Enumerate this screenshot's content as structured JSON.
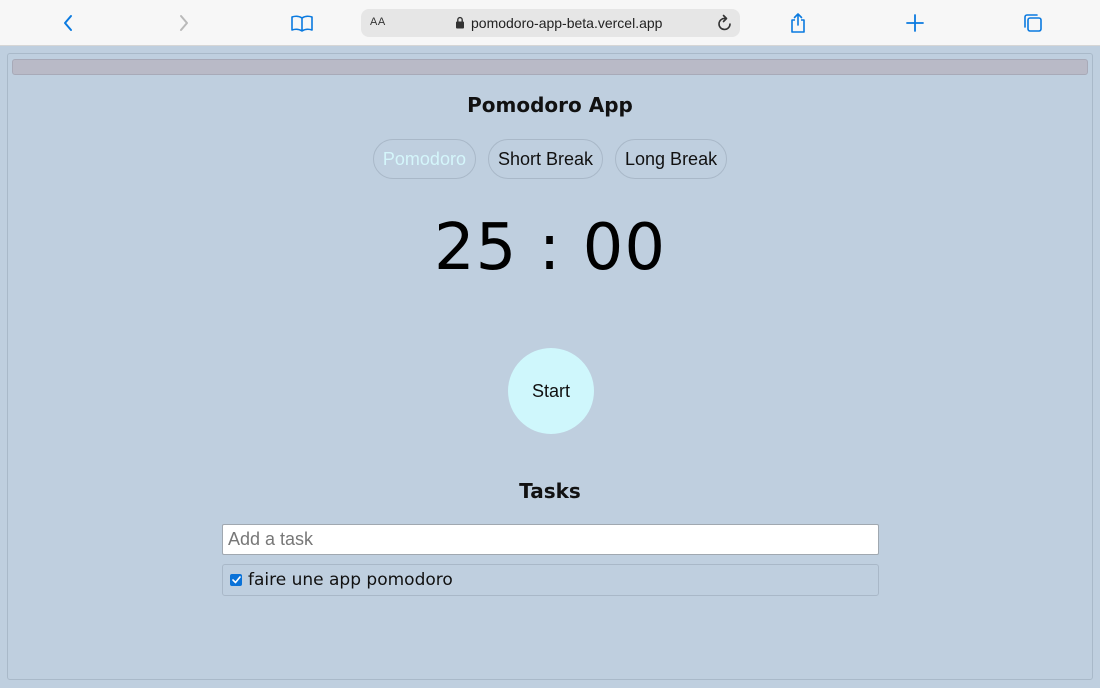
{
  "browser": {
    "text_size_label": "AA",
    "url": "pomodoro-app-beta.vercel.app",
    "accent_color": "#0a7ae0"
  },
  "app": {
    "title": "Pomodoro App",
    "modes": [
      {
        "label": "Pomodoro",
        "active": true
      },
      {
        "label": "Short Break",
        "active": false
      },
      {
        "label": "Long Break",
        "active": false
      }
    ],
    "timer": "25 : 00",
    "start_label": "Start"
  },
  "tasks": {
    "title": "Tasks",
    "input_placeholder": "Add a task",
    "items": [
      {
        "text": "faire une app pomodoro",
        "checked": true
      }
    ]
  }
}
